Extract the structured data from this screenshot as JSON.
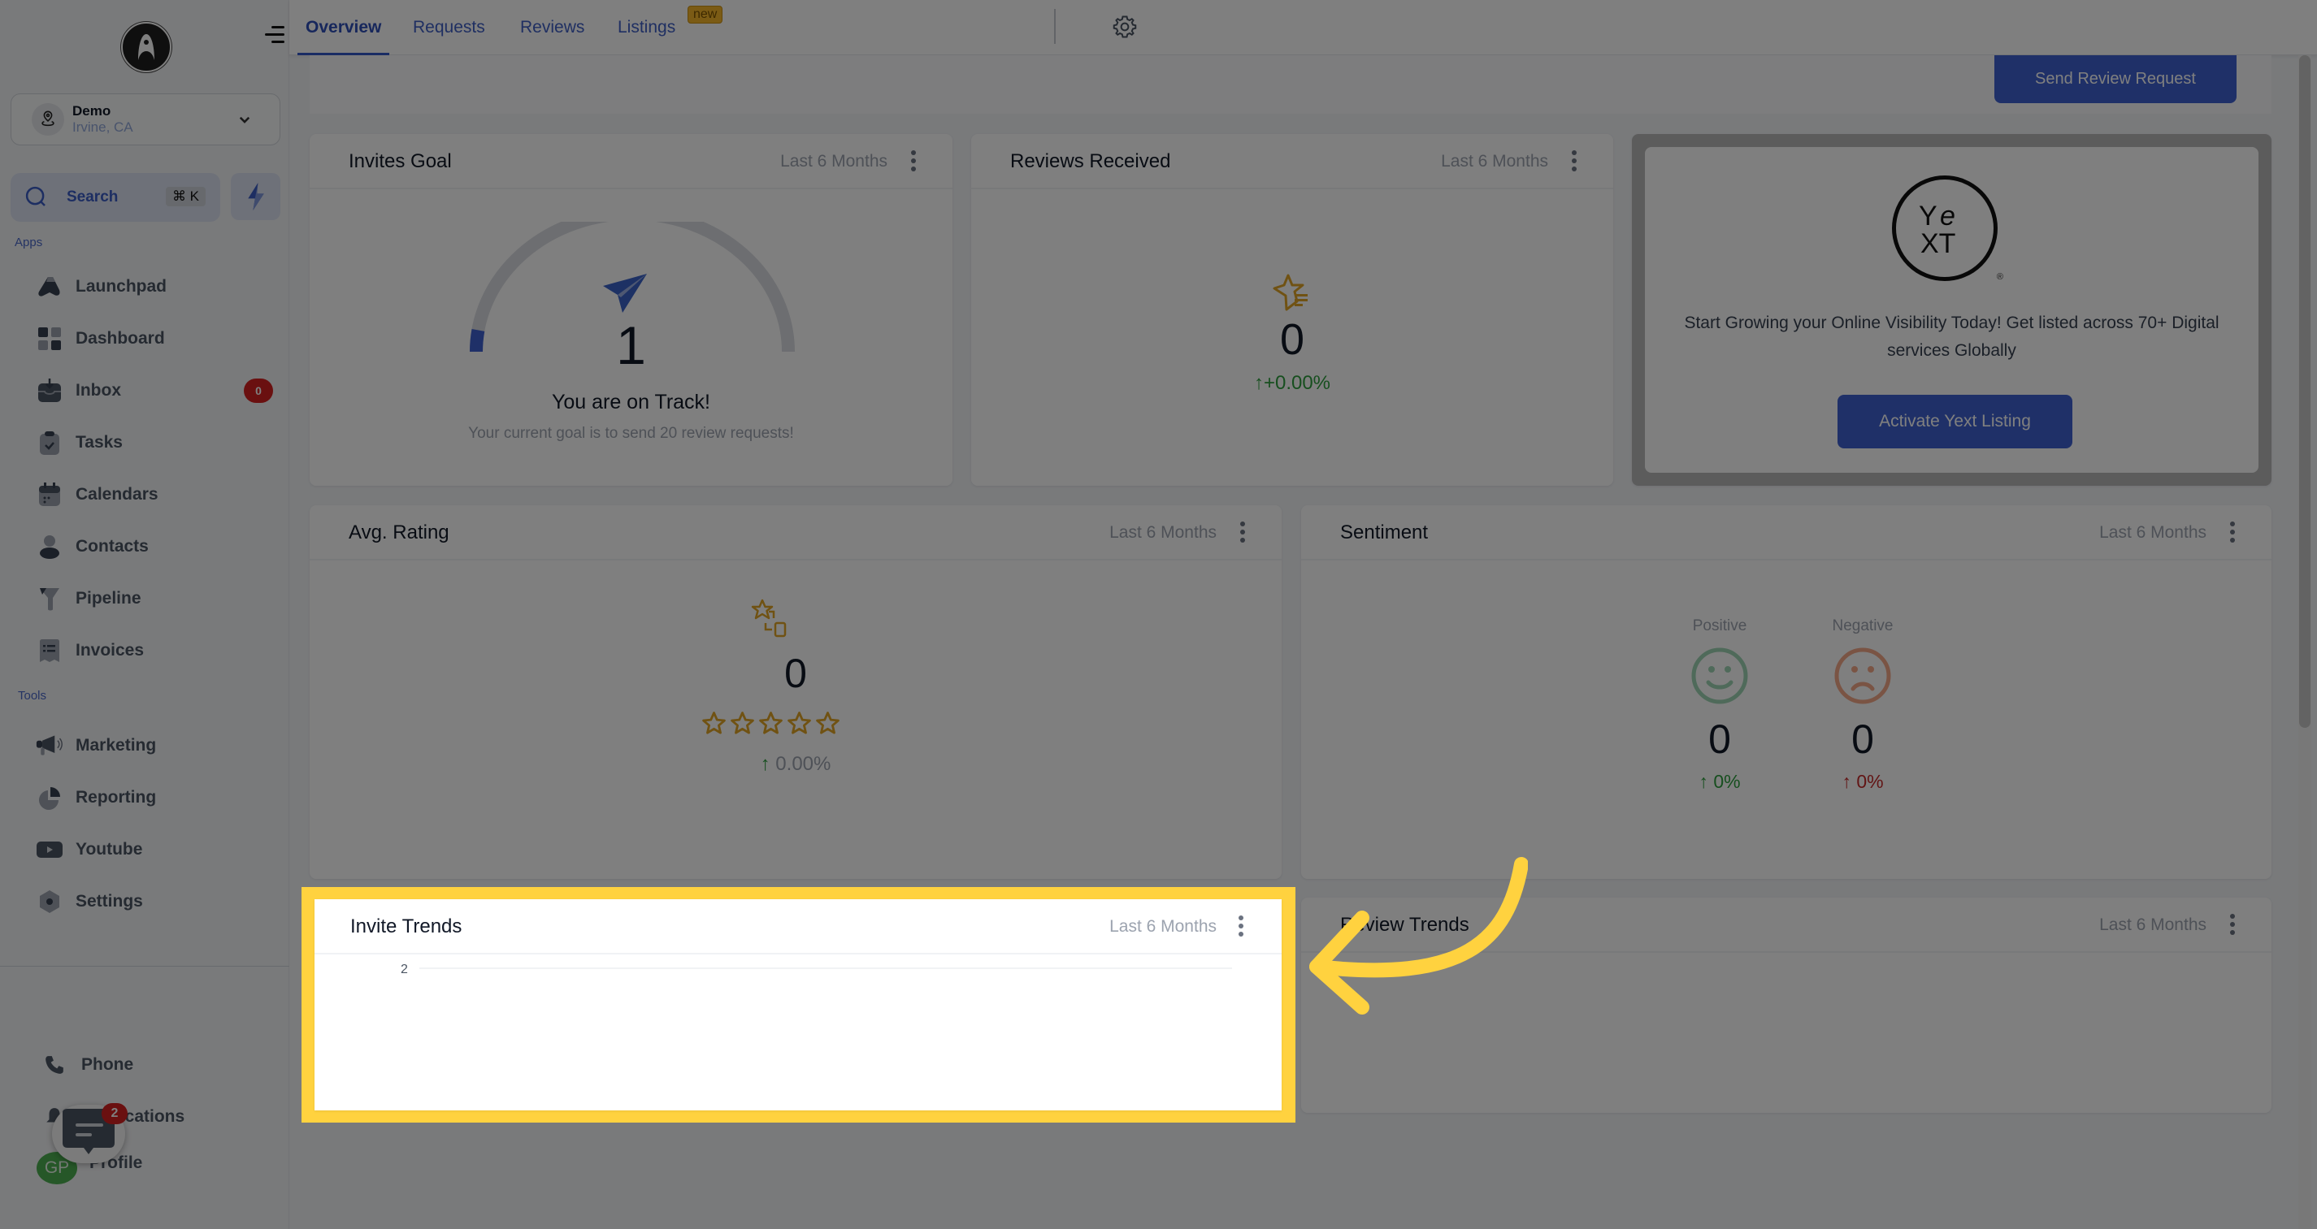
{
  "sidebar": {
    "location": {
      "name": "Demo",
      "sub": "Irvine, CA"
    },
    "search": {
      "label": "Search",
      "shortcut": "⌘ K"
    },
    "sections": {
      "apps": "Apps",
      "tools": "Tools"
    },
    "apps": [
      {
        "label": "Launchpad",
        "icon": "launchpad-icon"
      },
      {
        "label": "Dashboard",
        "icon": "dashboard-icon"
      },
      {
        "label": "Inbox",
        "icon": "inbox-icon",
        "badge": "0"
      },
      {
        "label": "Tasks",
        "icon": "tasks-icon"
      },
      {
        "label": "Calendars",
        "icon": "calendar-icon"
      },
      {
        "label": "Contacts",
        "icon": "contacts-icon"
      },
      {
        "label": "Pipeline",
        "icon": "pipeline-icon"
      },
      {
        "label": "Invoices",
        "icon": "invoices-icon"
      }
    ],
    "tools": [
      {
        "label": "Marketing",
        "icon": "megaphone-icon"
      },
      {
        "label": "Reporting",
        "icon": "pie-chart-icon"
      },
      {
        "label": "Youtube",
        "icon": "youtube-icon"
      },
      {
        "label": "Settings",
        "icon": "settings-icon"
      }
    ],
    "bottom": {
      "phone": "Phone",
      "notifications": "Notifications",
      "profile": "Profile",
      "avatar_initials": "GP"
    },
    "chat_widget": {
      "badge": "2"
    }
  },
  "topnav": {
    "tabs": [
      {
        "label": "Overview",
        "active": true
      },
      {
        "label": "Requests"
      },
      {
        "label": "Reviews"
      },
      {
        "label": "Listings",
        "badge": "new"
      }
    ]
  },
  "header": {
    "send_review_request": "Send Review Request"
  },
  "cards": {
    "invites_goal": {
      "title": "Invites Goal",
      "range": "Last 6 Months",
      "value": "1",
      "status": "You are on Track!",
      "goal_text": "Your current goal is to send 20 review requests!",
      "progress": {
        "current": 1,
        "goal": 20
      }
    },
    "reviews_received": {
      "title": "Reviews Received",
      "range": "Last 6 Months",
      "value": "0",
      "change": "+0.00%"
    },
    "yext": {
      "logo_text": "yext",
      "message": "Start Growing your Online Visibility Today! Get listed across 70+ Digital services Globally",
      "button": "Activate Yext Listing"
    },
    "avg_rating": {
      "title": "Avg. Rating",
      "range": "Last 6 Months",
      "value": "0",
      "stars": 0,
      "stars_max": 5,
      "change": "0.00%"
    },
    "sentiment": {
      "title": "Sentiment",
      "range": "Last 6 Months",
      "positive": {
        "label": "Positive",
        "value": "0",
        "change": "0%"
      },
      "negative": {
        "label": "Negative",
        "value": "0",
        "change": "0%"
      }
    },
    "invite_trends": {
      "title": "Invite Trends",
      "range": "Last 6 Months",
      "y_tick": "2"
    },
    "review_trends": {
      "title": "Review Trends",
      "range": "Last 6 Months"
    }
  },
  "colors": {
    "accent": "#3f61d0",
    "highlight": "#ffd23f",
    "positive": "#2e9e3e",
    "negative": "#c42a2a",
    "star": "#e0a526"
  }
}
